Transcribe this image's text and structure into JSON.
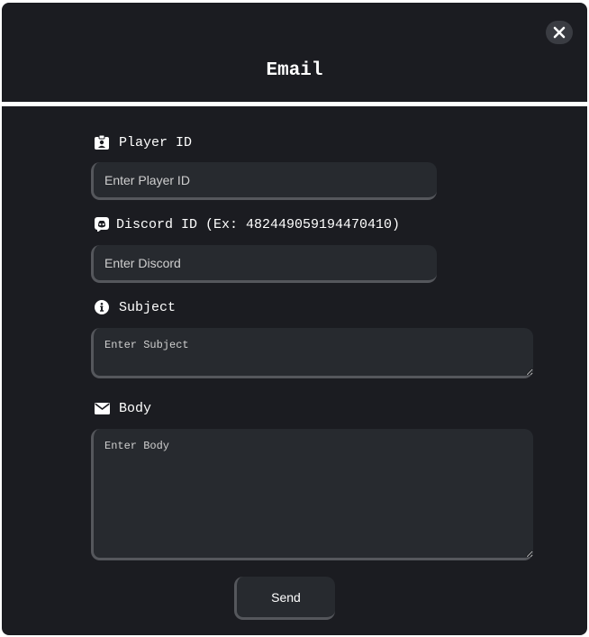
{
  "modal": {
    "title": "Email",
    "close_icon": "close-icon"
  },
  "fields": {
    "player_id": {
      "label": "Player ID",
      "icon": "id-badge-icon",
      "placeholder": "Enter Player ID"
    },
    "discord_id": {
      "label": "Discord ID (Ex: 482449059194470410)",
      "icon": "discord-icon",
      "placeholder": "Enter Discord"
    },
    "subject": {
      "label": "Subject",
      "icon": "info-circle-icon",
      "placeholder": "Enter Subject"
    },
    "body": {
      "label": "Body",
      "icon": "envelope-icon",
      "placeholder": "Enter Body"
    }
  },
  "actions": {
    "send_label": "Send"
  },
  "colors": {
    "background": "#1b1c21",
    "field_background": "#272a2f",
    "field_border": "#55575c",
    "text": "#ffffff"
  }
}
